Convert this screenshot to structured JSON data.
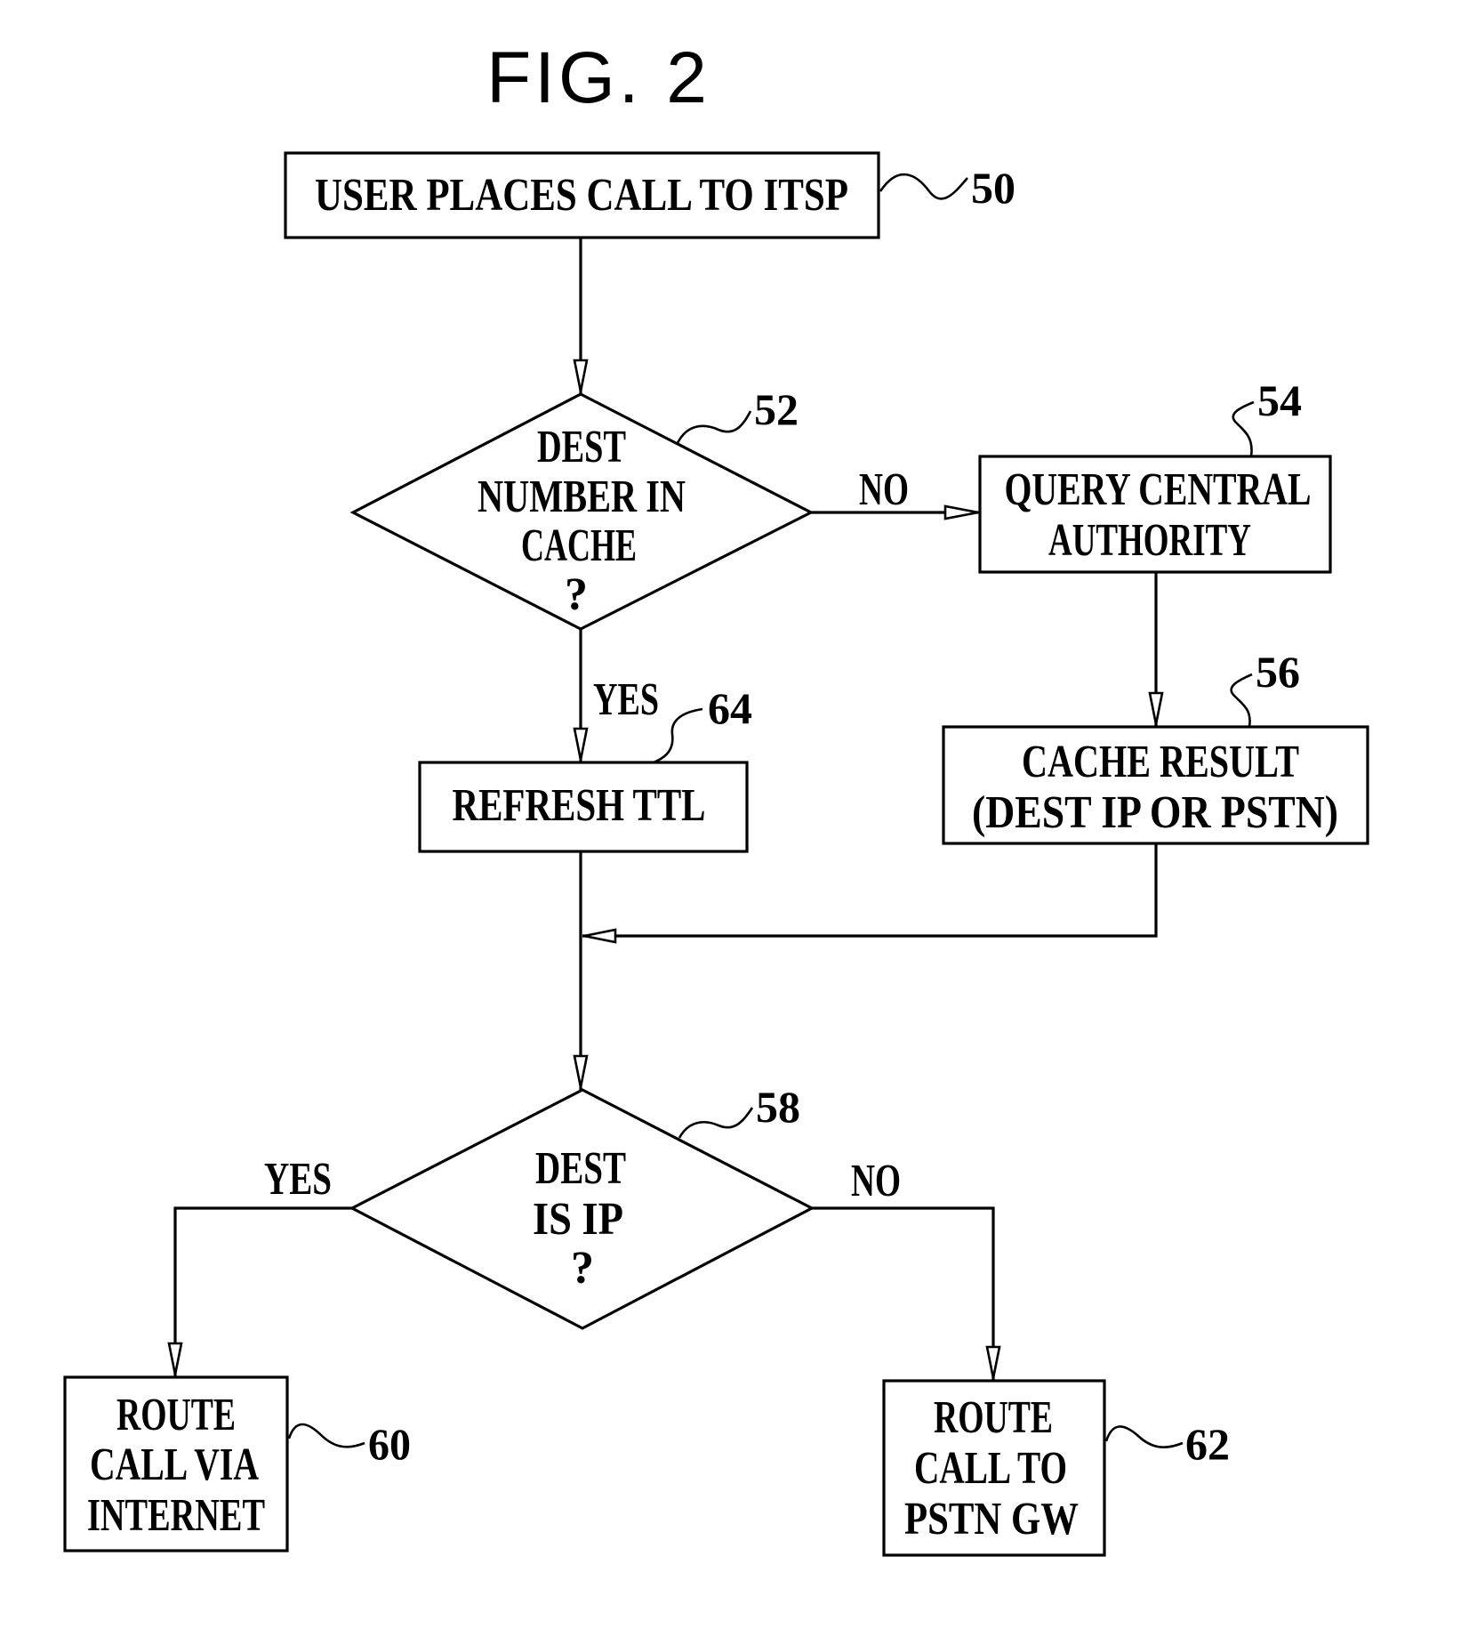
{
  "figure": {
    "title": "FIG. 2"
  },
  "nodes": {
    "n50": {
      "ref": "50",
      "type": "process",
      "lines": [
        "USER PLACES CALL TO ITSP"
      ]
    },
    "n52": {
      "ref": "52",
      "type": "decision",
      "lines": [
        "DEST",
        "NUMBER IN",
        "CACHE",
        "?"
      ]
    },
    "n54": {
      "ref": "54",
      "type": "process",
      "lines": [
        "QUERY CENTRAL",
        "AUTHORITY"
      ]
    },
    "n56": {
      "ref": "56",
      "type": "process",
      "lines": [
        "CACHE RESULT",
        "(DEST IP OR PSTN)"
      ]
    },
    "n64": {
      "ref": "64",
      "type": "process",
      "lines": [
        "REFRESH TTL"
      ]
    },
    "n58": {
      "ref": "58",
      "type": "decision",
      "lines": [
        "DEST",
        "IS IP",
        "?"
      ]
    },
    "n60": {
      "ref": "60",
      "type": "process",
      "lines": [
        "ROUTE",
        "CALL VIA",
        "INTERNET"
      ]
    },
    "n62": {
      "ref": "62",
      "type": "process",
      "lines": [
        "ROUTE",
        "CALL TO",
        "PSTN GW"
      ]
    }
  },
  "edges": [
    {
      "from": "50",
      "to": "52",
      "label": ""
    },
    {
      "from": "52",
      "to": "54",
      "label": "NO"
    },
    {
      "from": "52",
      "to": "64",
      "label": "YES"
    },
    {
      "from": "54",
      "to": "56",
      "label": ""
    },
    {
      "from": "56",
      "to": "58",
      "label": ""
    },
    {
      "from": "64",
      "to": "58",
      "label": ""
    },
    {
      "from": "58",
      "to": "60",
      "label": "YES"
    },
    {
      "from": "58",
      "to": "62",
      "label": "NO"
    }
  ],
  "edge_labels": {
    "e52_54": "NO",
    "e52_64": "YES",
    "e58_60": "YES",
    "e58_62": "NO"
  },
  "colors": {
    "ink": "#000000",
    "paper": "#ffffff"
  }
}
